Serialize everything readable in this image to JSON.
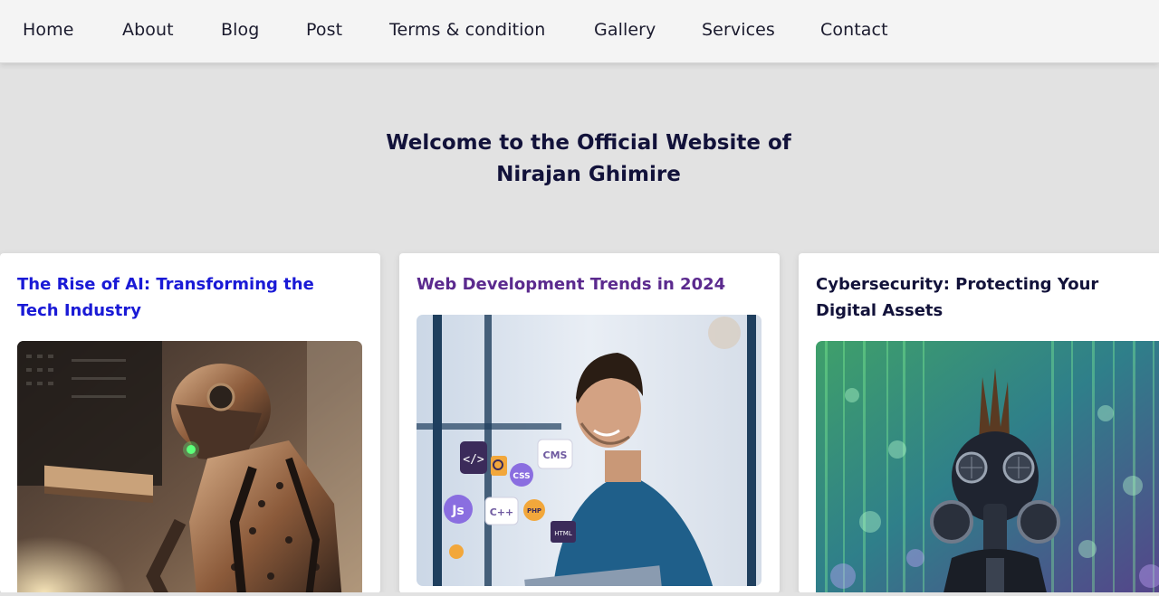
{
  "nav": {
    "items": [
      {
        "label": "Home",
        "name": "nav-home"
      },
      {
        "label": "About",
        "name": "nav-about"
      },
      {
        "label": "Blog",
        "name": "nav-blog"
      },
      {
        "label": "Post",
        "name": "nav-post"
      },
      {
        "label": "Terms & condition",
        "name": "nav-terms"
      },
      {
        "label": "Gallery",
        "name": "nav-gallery"
      },
      {
        "label": "Services",
        "name": "nav-services"
      },
      {
        "label": "Contact",
        "name": "nav-contact"
      }
    ]
  },
  "hero": {
    "line1": "Welcome to the Official Website of",
    "line2": "Nirajan Ghimire"
  },
  "cards": [
    {
      "title": "The Rise of AI: Transforming the Tech Industry",
      "title_color": "#1a1ad6",
      "image": "robot-image"
    },
    {
      "title": "Web Development Trends in 2024",
      "title_color": "#5b2a8e",
      "image": "developer-image"
    },
    {
      "title": "Cybersecurity: Protecting Your Digital Assets",
      "title_color": "#12123a",
      "image": "gas-mask-image"
    }
  ],
  "dev_icons": {
    "code": "</>",
    "css": "CSS",
    "cms": "CMS",
    "js": "Js",
    "cpp": "C++",
    "php": "PHP",
    "html": "HTML"
  }
}
